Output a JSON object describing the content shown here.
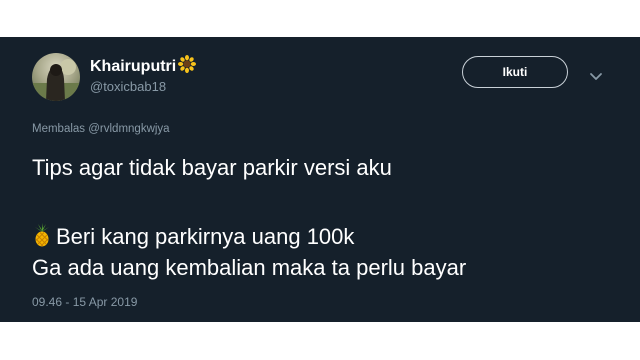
{
  "tweet": {
    "author": {
      "display_name": "Khairuputri",
      "handle": "@toxicbab18",
      "name_emoji": "sunflower-icon",
      "avatar_icon": "avatar"
    },
    "follow_button_label": "Ikuti",
    "reply_context": {
      "prefix": "Membalas ",
      "mention": "@rvldmngkwjya"
    },
    "text_lines": [
      "Tips agar tidak bayar parkir versi aku",
      "Beri kang parkirnya uang 100k",
      " Ga ada uang kembalian maka ta perlu bayar"
    ],
    "line_emoji": "pineapple-icon",
    "timestamp": "09.46 - 15 Apr 2019"
  },
  "colors": {
    "background": "#15202b",
    "text": "#ffffff",
    "secondary_text": "#8899a6",
    "button_border": "#c9d1d8"
  }
}
